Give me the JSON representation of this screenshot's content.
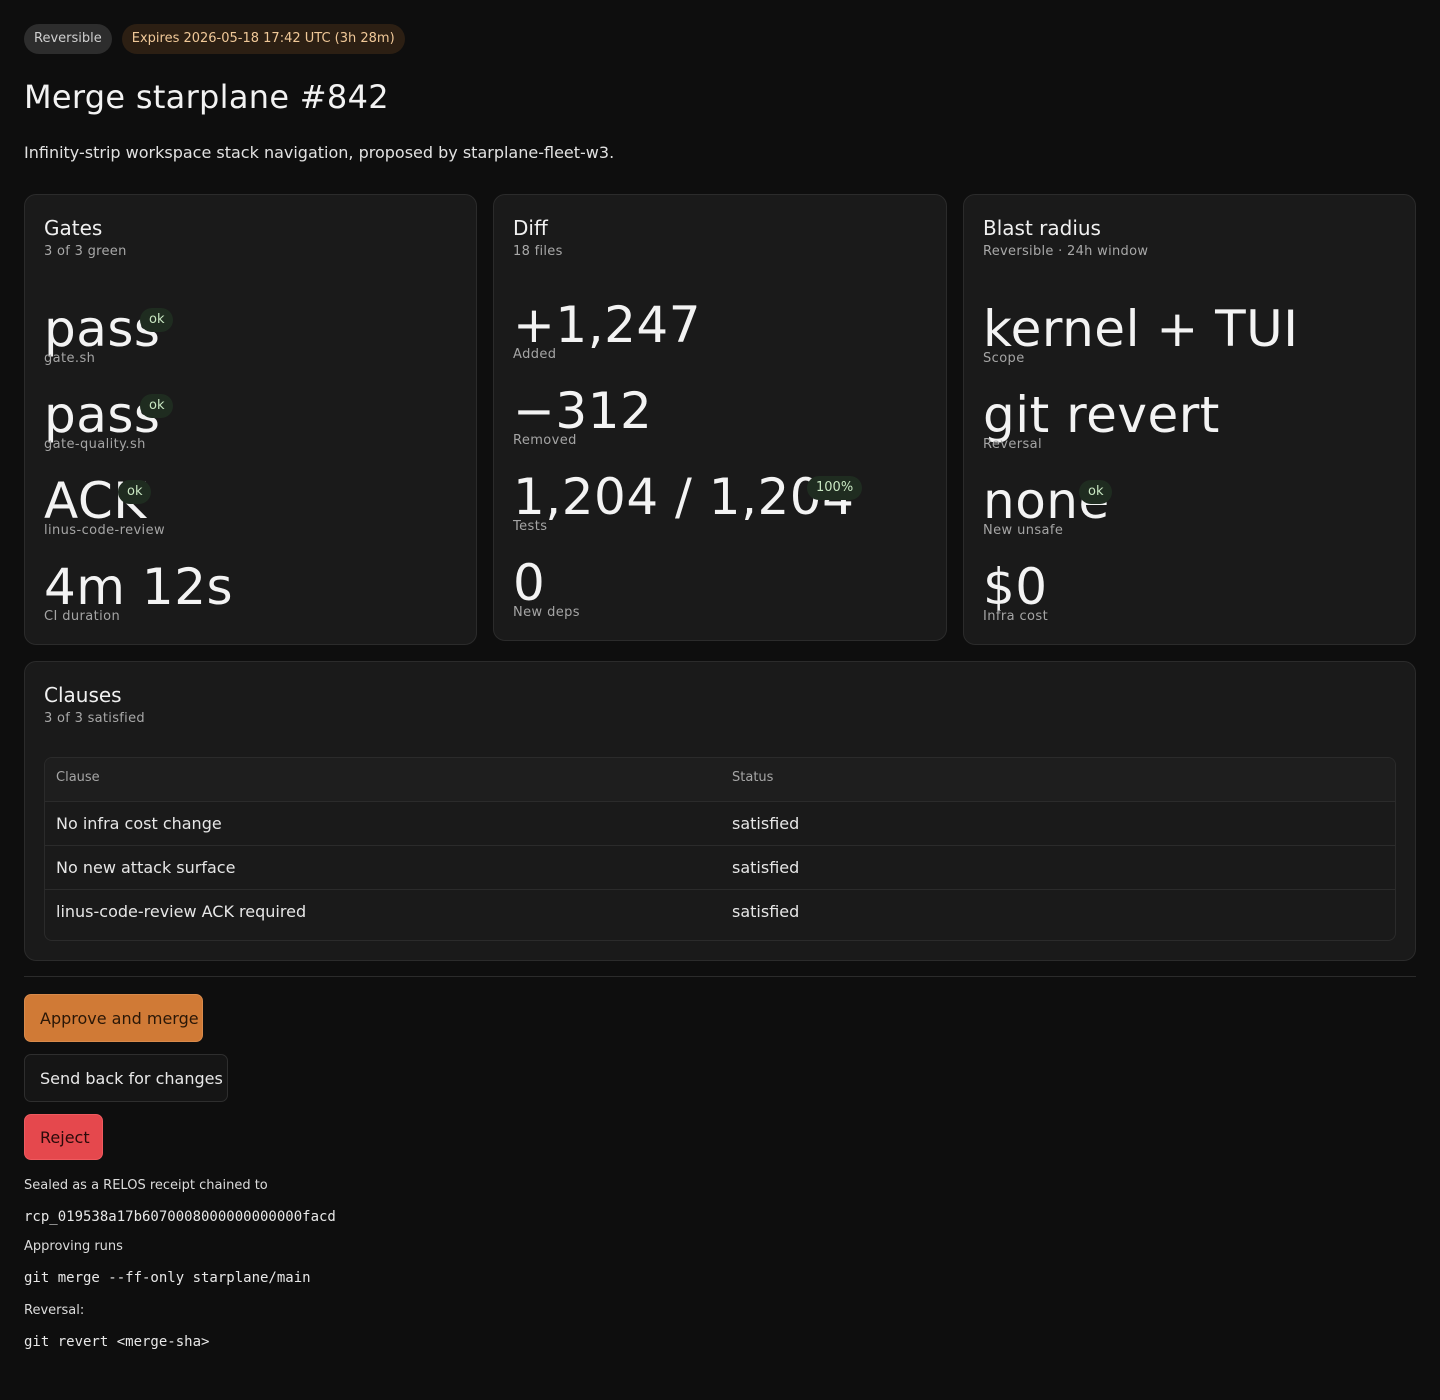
{
  "header": {
    "badge_reversible": "Reversible",
    "badge_expires": "Expires 2026-05-18 17:42 UTC (3h 28m)",
    "title": "Merge starplane #842",
    "subtitle": "Infinity-strip workspace stack navigation, proposed by starplane-fleet-w3."
  },
  "gates": {
    "title": "Gates",
    "subtitle": "3 of 3 green",
    "metrics": [
      {
        "value": "pass",
        "label": "gate.sh",
        "badge": "ok"
      },
      {
        "value": "pass",
        "label": "gate-quality.sh",
        "badge": "ok"
      },
      {
        "value": "ACK",
        "label": "linus-code-review",
        "badge": "ok"
      },
      {
        "value": "4m 12s",
        "label": "CI duration"
      }
    ]
  },
  "diff": {
    "title": "Diff",
    "subtitle": "18 files",
    "metrics": [
      {
        "value": "+1,247",
        "label": "Added"
      },
      {
        "value": "−312",
        "label": "Removed"
      },
      {
        "value": "1,204 / 1,204",
        "label": "Tests",
        "badge": "100%"
      },
      {
        "value": "0",
        "label": "New deps"
      }
    ]
  },
  "blast": {
    "title": "Blast radius",
    "subtitle": "Reversible · 24h window",
    "metrics": [
      {
        "value": "kernel + TUI",
        "label": "Scope"
      },
      {
        "value": "git revert",
        "label": "Reversal"
      },
      {
        "value": "none",
        "label": "New unsafe",
        "badge": "ok"
      },
      {
        "value": "$0",
        "label": "Infra cost"
      }
    ]
  },
  "clauses": {
    "title": "Clauses",
    "subtitle": "3 of 3 satisfied",
    "columns": [
      "Clause",
      "Status"
    ],
    "rows": [
      {
        "clause": "No infra cost change",
        "status": "satisfied"
      },
      {
        "clause": "No new attack surface",
        "status": "satisfied"
      },
      {
        "clause": "linus-code-review ACK required",
        "status": "satisfied"
      }
    ]
  },
  "actions": {
    "approve": "Approve and merge",
    "send_back": "Send back for changes",
    "reject": "Reject"
  },
  "footer": {
    "sealed_label": "Sealed as a RELOS receipt chained to",
    "receipt_id": "rcp_019538a17b6070008000000000000facd",
    "approving_label": "Approving runs",
    "approving_cmd": "git merge --ff-only starplane/main",
    "reversal_label": "Reversal:",
    "reversal_cmd": "git revert <merge-sha>"
  },
  "colors": {
    "background": "#0e0e0e",
    "card": "#1a1a1a",
    "accent_orange": "#d07a36",
    "danger_red": "#e5484d",
    "ok_green": "#1f2c20"
  }
}
